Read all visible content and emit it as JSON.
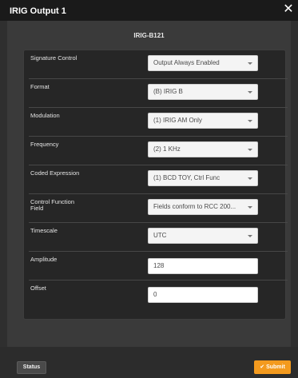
{
  "window": {
    "title": "IRIG Output 1",
    "close_glyph": "✕"
  },
  "subtitle": "IRIG-B121",
  "fields": [
    {
      "label": "Signature Control",
      "value": "Output Always Enabled",
      "type": "select"
    },
    {
      "label": "Format",
      "value": "(B) IRIG B",
      "type": "select"
    },
    {
      "label": "Modulation",
      "value": "(1) IRIG AM Only",
      "type": "select"
    },
    {
      "label": "Frequency",
      "value": "(2) 1 KHz",
      "type": "select"
    },
    {
      "label": "Coded Expression",
      "value": "(1) BCD TOY, Ctrl Func",
      "type": "select"
    },
    {
      "label": "Control Function Field",
      "value": "Fields conform to RCC 200...",
      "type": "select"
    },
    {
      "label": "Timescale",
      "value": "UTC",
      "type": "select"
    },
    {
      "label": "Amplitude",
      "value": "128",
      "type": "input"
    },
    {
      "label": "Offset",
      "value": "0",
      "type": "input"
    }
  ],
  "footer": {
    "status_label": "Status",
    "submit_label": "Submit",
    "submit_icon": "check-icon"
  },
  "colors": {
    "accent": "#f39a1e",
    "title_bar": "#1a1a1a",
    "panel": "#262626"
  }
}
